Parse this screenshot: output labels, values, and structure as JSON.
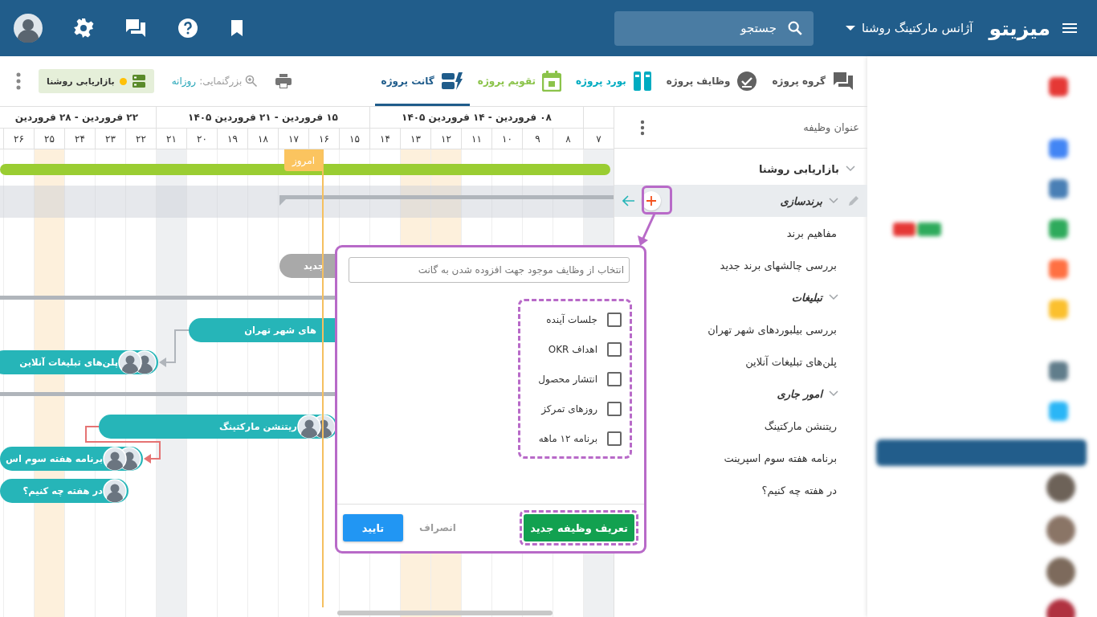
{
  "topbar": {
    "logo": "میزیتو",
    "org": "آژانس مارکتینگ روشنا",
    "search_placeholder": "جستجو"
  },
  "tabs": [
    {
      "label": "گروه پروژه",
      "color": "#616161",
      "selected": false
    },
    {
      "label": "وظایف پروژه",
      "color": "#616161",
      "selected": false
    },
    {
      "label": "بورد پروژه",
      "color": "#00acc1",
      "selected": false
    },
    {
      "label": "تقویم پروژه",
      "color": "#8bc34a",
      "selected": false
    },
    {
      "label": "گانت پروژه",
      "color": "#1f5c8b",
      "selected": true
    }
  ],
  "toolbar": {
    "zoom_label": "بزرگنمایی:",
    "zoom_value": "روزانه",
    "project": {
      "label": "بازاریابی روشنا",
      "color": "#ffc107"
    }
  },
  "task_header": "عنوان وظیفه",
  "tasks": [
    {
      "title": "بازاریابی روشنا",
      "expanded": true,
      "selected": false,
      "children": [
        {
          "title": "برندسازی",
          "expanded": true,
          "selected": true,
          "children": [
            {
              "title": "مفاهیم برند",
              "selected": false
            },
            {
              "title": "بررسی چالشهای برند جدید",
              "selected": false
            }
          ]
        },
        {
          "title": "تبلیغات",
          "expanded": true,
          "selected": false,
          "children": [
            {
              "title": "بررسی بیلبوردهای شهر تهران",
              "selected": false
            },
            {
              "title": "پلن‌های تبلیغات آنلاین",
              "selected": false
            }
          ]
        },
        {
          "title": "امور جاری",
          "expanded": true,
          "selected": false,
          "children": [
            {
              "title": "ریتنشن مارکتینگ",
              "selected": false
            },
            {
              "title": "برنامه هفته سوم اسپرینت",
              "selected": false
            },
            {
              "title": "در هفته چه کنیم؟",
              "selected": false
            }
          ]
        }
      ]
    }
  ],
  "weeks": [
    "۰۸ فروردین - ۱۴ فروردین ۱۴۰۵",
    "۱۵ فروردین - ۲۱ فروردین ۱۴۰۵",
    "۲۲ فروردین - ۲۸ فروردین"
  ],
  "days": [
    {
      "label": "۷",
      "weekend": true,
      "holiday": false
    },
    {
      "label": "۸",
      "weekend": false,
      "holiday": false
    },
    {
      "label": "۹",
      "weekend": false,
      "holiday": false
    },
    {
      "label": "۱۰",
      "weekend": false,
      "holiday": false
    },
    {
      "label": "۱۱",
      "weekend": false,
      "holiday": false
    },
    {
      "label": "۱۲",
      "weekend": false,
      "holiday": true
    },
    {
      "label": "۱۳",
      "weekend": false,
      "holiday": true
    },
    {
      "label": "۱۴",
      "weekend": false,
      "holiday": false
    },
    {
      "label": "۱۵",
      "weekend": false,
      "holiday": false
    },
    {
      "label": "۱۶",
      "weekend": false,
      "holiday": false
    },
    {
      "label": "۱۷",
      "weekend": false,
      "holiday": false
    },
    {
      "label": "۱۸",
      "weekend": false,
      "holiday": false
    },
    {
      "label": "۱۹",
      "weekend": false,
      "holiday": false
    },
    {
      "label": "۲۰",
      "weekend": false,
      "holiday": false
    },
    {
      "label": "۲۱",
      "weekend": true,
      "holiday": false
    },
    {
      "label": "۲۲",
      "weekend": false,
      "holiday": false
    },
    {
      "label": "۲۳",
      "weekend": false,
      "holiday": false
    },
    {
      "label": "۲۴",
      "weekend": false,
      "holiday": false
    },
    {
      "label": "۲۵",
      "weekend": false,
      "holiday": true
    },
    {
      "label": "۲۶",
      "weekend": false,
      "holiday": false
    }
  ],
  "today_label": "امروز",
  "bars": [
    {
      "kind": "summary"
    },
    {
      "kind": "bracket"
    },
    {
      "kind": "draft",
      "label": "جدید"
    },
    {
      "kind": "line"
    },
    {
      "kind": "task",
      "label": "های شهر تهران"
    },
    {
      "kind": "task",
      "label": "پلن‌های تبلیغات آنلاین"
    },
    {
      "kind": "line"
    },
    {
      "kind": "task",
      "label": "ریتنشن مارکتینگ"
    },
    {
      "kind": "task",
      "label": "برنامه هفته سوم اس"
    },
    {
      "kind": "task",
      "label": "در هفته چه کنیم؟"
    }
  ],
  "popup": {
    "search_placeholder": "انتخاب از وظایف موجود جهت افزوده شدن به گانت",
    "options": [
      {
        "label": "جلسات آینده",
        "checked": false
      },
      {
        "label": "اهداف OKR",
        "checked": false
      },
      {
        "label": "انتشار محصول",
        "checked": false
      },
      {
        "label": "روزهای تمرکز",
        "checked": false
      },
      {
        "label": "برنامه ۱۲ ماهه",
        "checked": false
      }
    ],
    "new_task": "تعریف وظیفه جدید",
    "cancel": "انصراف",
    "confirm": "تایید"
  }
}
